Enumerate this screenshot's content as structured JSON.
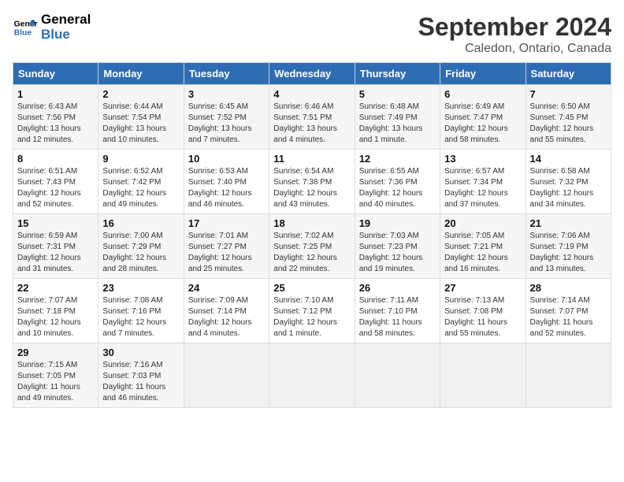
{
  "header": {
    "logo_line1": "General",
    "logo_line2": "Blue",
    "month": "September 2024",
    "location": "Caledon, Ontario, Canada"
  },
  "weekdays": [
    "Sunday",
    "Monday",
    "Tuesday",
    "Wednesday",
    "Thursday",
    "Friday",
    "Saturday"
  ],
  "weeks": [
    [
      {
        "day": "1",
        "info": "Sunrise: 6:43 AM\nSunset: 7:56 PM\nDaylight: 13 hours\nand 12 minutes."
      },
      {
        "day": "2",
        "info": "Sunrise: 6:44 AM\nSunset: 7:54 PM\nDaylight: 13 hours\nand 10 minutes."
      },
      {
        "day": "3",
        "info": "Sunrise: 6:45 AM\nSunset: 7:52 PM\nDaylight: 13 hours\nand 7 minutes."
      },
      {
        "day": "4",
        "info": "Sunrise: 6:46 AM\nSunset: 7:51 PM\nDaylight: 13 hours\nand 4 minutes."
      },
      {
        "day": "5",
        "info": "Sunrise: 6:48 AM\nSunset: 7:49 PM\nDaylight: 13 hours\nand 1 minute."
      },
      {
        "day": "6",
        "info": "Sunrise: 6:49 AM\nSunset: 7:47 PM\nDaylight: 12 hours\nand 58 minutes."
      },
      {
        "day": "7",
        "info": "Sunrise: 6:50 AM\nSunset: 7:45 PM\nDaylight: 12 hours\nand 55 minutes."
      }
    ],
    [
      {
        "day": "8",
        "info": "Sunrise: 6:51 AM\nSunset: 7:43 PM\nDaylight: 12 hours\nand 52 minutes."
      },
      {
        "day": "9",
        "info": "Sunrise: 6:52 AM\nSunset: 7:42 PM\nDaylight: 12 hours\nand 49 minutes."
      },
      {
        "day": "10",
        "info": "Sunrise: 6:53 AM\nSunset: 7:40 PM\nDaylight: 12 hours\nand 46 minutes."
      },
      {
        "day": "11",
        "info": "Sunrise: 6:54 AM\nSunset: 7:38 PM\nDaylight: 12 hours\nand 43 minutes."
      },
      {
        "day": "12",
        "info": "Sunrise: 6:55 AM\nSunset: 7:36 PM\nDaylight: 12 hours\nand 40 minutes."
      },
      {
        "day": "13",
        "info": "Sunrise: 6:57 AM\nSunset: 7:34 PM\nDaylight: 12 hours\nand 37 minutes."
      },
      {
        "day": "14",
        "info": "Sunrise: 6:58 AM\nSunset: 7:32 PM\nDaylight: 12 hours\nand 34 minutes."
      }
    ],
    [
      {
        "day": "15",
        "info": "Sunrise: 6:59 AM\nSunset: 7:31 PM\nDaylight: 12 hours\nand 31 minutes."
      },
      {
        "day": "16",
        "info": "Sunrise: 7:00 AM\nSunset: 7:29 PM\nDaylight: 12 hours\nand 28 minutes."
      },
      {
        "day": "17",
        "info": "Sunrise: 7:01 AM\nSunset: 7:27 PM\nDaylight: 12 hours\nand 25 minutes."
      },
      {
        "day": "18",
        "info": "Sunrise: 7:02 AM\nSunset: 7:25 PM\nDaylight: 12 hours\nand 22 minutes."
      },
      {
        "day": "19",
        "info": "Sunrise: 7:03 AM\nSunset: 7:23 PM\nDaylight: 12 hours\nand 19 minutes."
      },
      {
        "day": "20",
        "info": "Sunrise: 7:05 AM\nSunset: 7:21 PM\nDaylight: 12 hours\nand 16 minutes."
      },
      {
        "day": "21",
        "info": "Sunrise: 7:06 AM\nSunset: 7:19 PM\nDaylight: 12 hours\nand 13 minutes."
      }
    ],
    [
      {
        "day": "22",
        "info": "Sunrise: 7:07 AM\nSunset: 7:18 PM\nDaylight: 12 hours\nand 10 minutes."
      },
      {
        "day": "23",
        "info": "Sunrise: 7:08 AM\nSunset: 7:16 PM\nDaylight: 12 hours\nand 7 minutes."
      },
      {
        "day": "24",
        "info": "Sunrise: 7:09 AM\nSunset: 7:14 PM\nDaylight: 12 hours\nand 4 minutes."
      },
      {
        "day": "25",
        "info": "Sunrise: 7:10 AM\nSunset: 7:12 PM\nDaylight: 12 hours\nand 1 minute."
      },
      {
        "day": "26",
        "info": "Sunrise: 7:11 AM\nSunset: 7:10 PM\nDaylight: 11 hours\nand 58 minutes."
      },
      {
        "day": "27",
        "info": "Sunrise: 7:13 AM\nSunset: 7:08 PM\nDaylight: 11 hours\nand 55 minutes."
      },
      {
        "day": "28",
        "info": "Sunrise: 7:14 AM\nSunset: 7:07 PM\nDaylight: 11 hours\nand 52 minutes."
      }
    ],
    [
      {
        "day": "29",
        "info": "Sunrise: 7:15 AM\nSunset: 7:05 PM\nDaylight: 11 hours\nand 49 minutes."
      },
      {
        "day": "30",
        "info": "Sunrise: 7:16 AM\nSunset: 7:03 PM\nDaylight: 11 hours\nand 46 minutes."
      },
      null,
      null,
      null,
      null,
      null
    ]
  ]
}
